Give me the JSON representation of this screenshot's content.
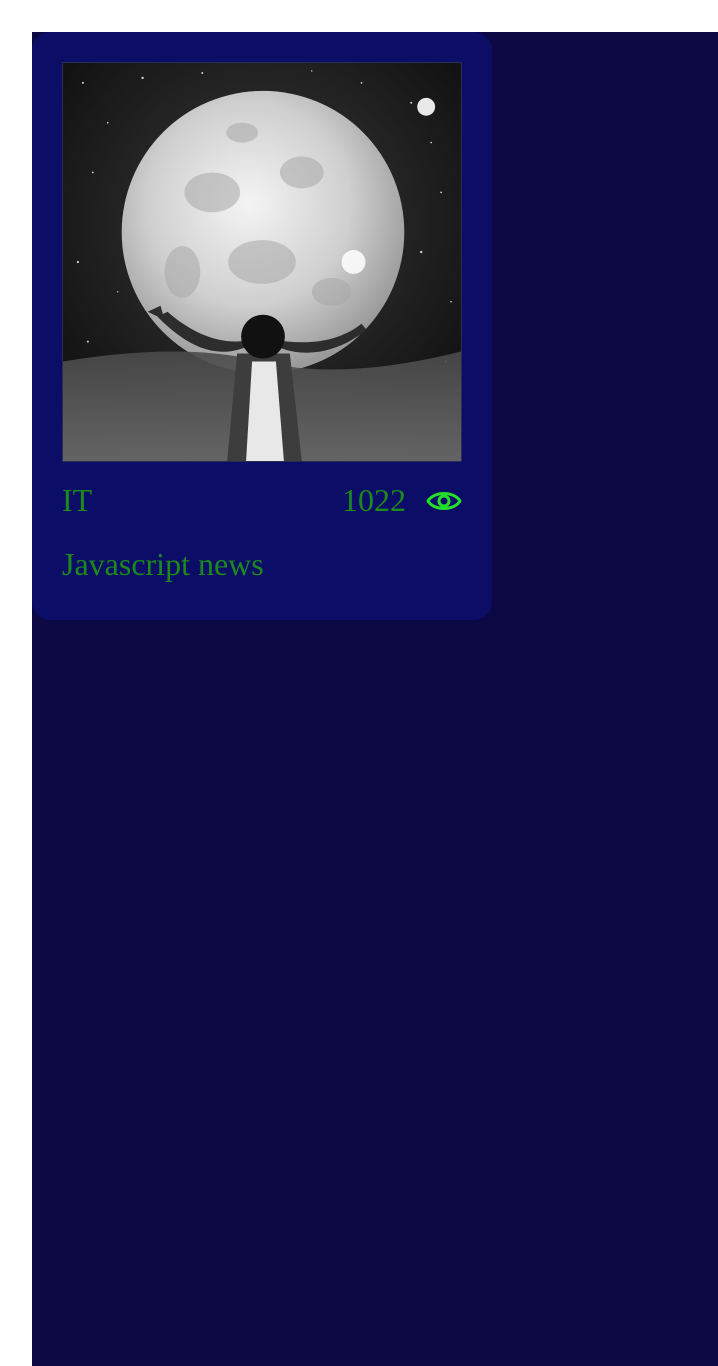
{
  "card": {
    "image_alt": "Person reaching toward a giant full moon in a starry sky",
    "category": "IT",
    "views": "1022",
    "view_icon": "eye-icon",
    "title": "Javascript news"
  },
  "colors": {
    "page_background": "#0b0844",
    "card_background": "#0c0d66",
    "text": "#1b8a1b",
    "icon": "#22e02a"
  }
}
